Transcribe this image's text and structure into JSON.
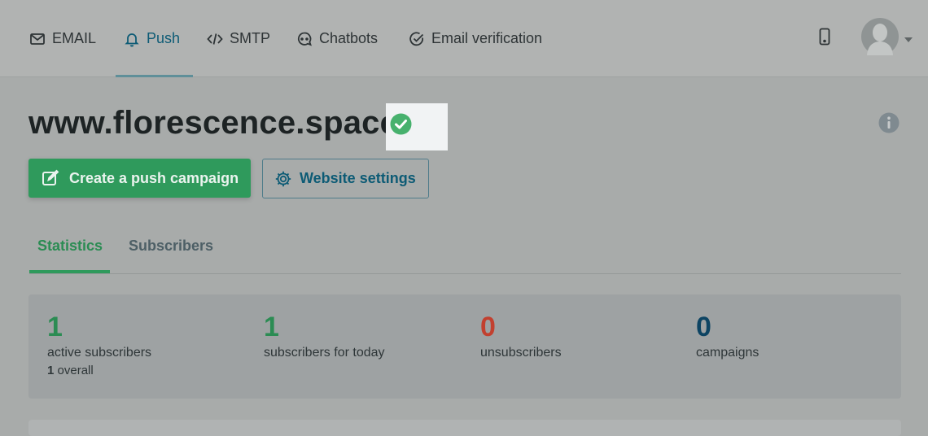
{
  "nav": {
    "items": [
      {
        "label": "EMAIL",
        "icon": "envelope-icon"
      },
      {
        "label": "Push",
        "icon": "bell-icon",
        "active": true
      },
      {
        "label": "SMTP",
        "icon": "code-icon"
      },
      {
        "label": "Chatbots",
        "icon": "chat-icon"
      },
      {
        "label": "Email verification",
        "icon": "check-circle-icon"
      }
    ]
  },
  "page": {
    "title": "www.florescence.space"
  },
  "actions": {
    "create_campaign": "Create a push campaign",
    "website_settings": "Website settings"
  },
  "tabs": {
    "statistics": "Statistics",
    "subscribers": "Subscribers"
  },
  "stats": {
    "active": {
      "value": "1",
      "label": "active subscribers",
      "overall_count": "1",
      "overall_label": "overall"
    },
    "today": {
      "value": "1",
      "label": "subscribers for today"
    },
    "unsubscribers": {
      "value": "0",
      "label": "unsubscribers"
    },
    "campaigns": {
      "value": "0",
      "label": "campaigns"
    }
  },
  "colors": {
    "accent_green": "#2f9a5c",
    "accent_blue": "#0d5b75",
    "danger_red": "#c2402f",
    "navy": "#0d4463"
  }
}
